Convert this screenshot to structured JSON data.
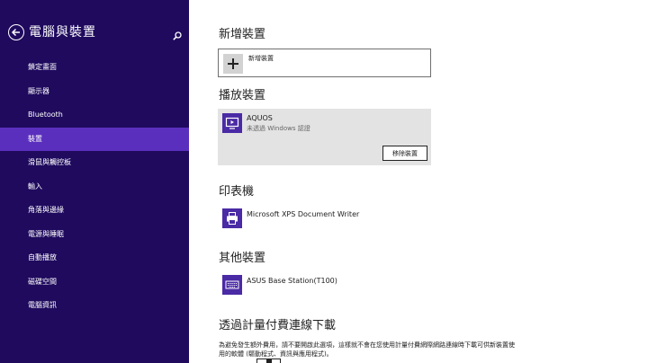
{
  "sidebar": {
    "title": "電腦與裝置",
    "items": [
      {
        "label": "鎖定畫面"
      },
      {
        "label": "顯示器"
      },
      {
        "label": "Bluetooth"
      },
      {
        "label": "裝置",
        "active": true
      },
      {
        "label": "滑鼠與觸控板"
      },
      {
        "label": "輸入"
      },
      {
        "label": "角落與邊緣"
      },
      {
        "label": "電源與睡眠"
      },
      {
        "label": "自動播放"
      },
      {
        "label": "磁碟空間"
      },
      {
        "label": "電腦資訊"
      }
    ]
  },
  "main": {
    "add_section": {
      "title": "新增裝置",
      "add_label": "新增裝置"
    },
    "play_section": {
      "title": "播放裝置",
      "device": {
        "name": "AQUOS",
        "status": "未透過 Windows 認證",
        "remove_label": "移除裝置"
      }
    },
    "printer_section": {
      "title": "印表機",
      "device": {
        "name": "Microsoft XPS Document Writer"
      }
    },
    "other_section": {
      "title": "其他裝置",
      "device": {
        "name": "ASUS Base Station(T100)"
      }
    },
    "metered_section": {
      "title": "透過計量付費連線下載",
      "description": "為避免發生額外費用，請不要開啟此選項，這樣就不會在您使用計量付費網際網路連線時下載可供新裝置使用的軟體 (驅動程式、資訊與應用程式)。"
    }
  },
  "colors": {
    "sidebar_bg": "#1f0a5e",
    "active_item": "#5b2fbe",
    "device_icon": "#4a2aa5"
  }
}
